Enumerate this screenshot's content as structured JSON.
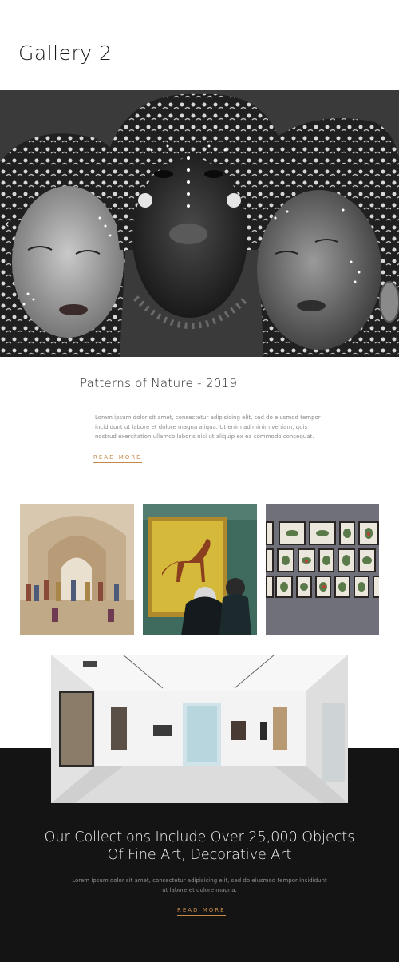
{
  "page": {
    "title": "Gallery 2"
  },
  "hero": {
    "arrow_icon": "chevron-left-icon"
  },
  "feature": {
    "title": "Patterns of Nature - 2019",
    "body": "Lorem ipsum dolor sit amet, consectetur adipisicing elit, sed do eiusmod tempor incididunt ut labore et dolore magna aliqua. Ut enim ad minim veniam, quis nostrud exercitation ullamco laboris nisi ut aliquip ex ea commodo consequat.",
    "read_more": "READ MORE"
  },
  "collections": {
    "heading_line1": "Our Collections Include Over 25,000 Objects",
    "heading_line2": "Of Fine Art, Decorative Art",
    "body": "Lorem ipsum dolor sit amet, consectetur adipisicing elit, sed do eiusmod tempor incididunt ut labore et dolore magna.",
    "read_more": "READ MORE"
  },
  "colors": {
    "accent": "#c58a4a",
    "dark_band": "#141414"
  }
}
